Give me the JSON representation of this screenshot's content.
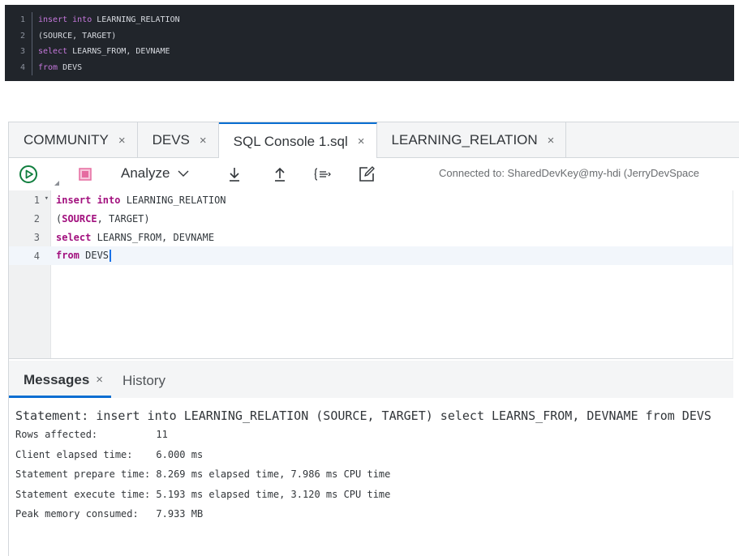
{
  "snippet": {
    "lines": [
      {
        "num": "1",
        "kw": "insert into",
        "rest": " LEARNING_RELATION"
      },
      {
        "num": "2",
        "kw": "",
        "rest": "(SOURCE, TARGET)"
      },
      {
        "num": "3",
        "kw": "select",
        "rest": " LEARNS_FROM, DEVNAME"
      },
      {
        "num": "4",
        "kw": "from",
        "rest": " DEVS"
      }
    ]
  },
  "tabs": [
    {
      "label": "COMMUNITY",
      "close": "×"
    },
    {
      "label": "DEVS",
      "close": "×"
    },
    {
      "label": "SQL Console 1.sql",
      "close": "×"
    },
    {
      "label": "LEARNING_RELATION",
      "close": "×"
    }
  ],
  "toolbar": {
    "analyze_label": "Analyze",
    "connection_text": "Connected to: SharedDevKey@my-hdi (JerryDevSpace"
  },
  "editor": {
    "lines": [
      {
        "num": "1",
        "fold": "▾",
        "kw": "insert into",
        "rest": " LEARNING_RELATION"
      },
      {
        "num": "2",
        "fold": "",
        "kw": "",
        "rest": "(SOURCE, TARGET)"
      },
      {
        "num": "3",
        "fold": "",
        "kw": "select",
        "rest": " LEARNS_FROM, DEVNAME"
      },
      {
        "num": "4",
        "fold": "",
        "kw": "from",
        "rest": " DEVS"
      }
    ],
    "line2_kw": "SOURCE"
  },
  "message_tabs": {
    "messages_label": "Messages",
    "messages_close": "×",
    "history_label": "History"
  },
  "messages": {
    "statement": "Statement: insert into LEARNING_RELATION (SOURCE, TARGET) select LEARNS_FROM, DEVNAME from DEVS",
    "stats": [
      "Rows affected:          11",
      "Client elapsed time:    6.000 ms",
      "Statement prepare time: 8.269 ms elapsed time, 7.986 ms CPU time",
      "Statement execute time: 5.193 ms elapsed time, 3.120 ms CPU time",
      "Peak memory consumed:   7.933 MB"
    ]
  },
  "colors": {
    "accent": "#0a6ed1",
    "run_green": "#107e3e",
    "stop_pink": "#e56ba0",
    "sql_keyword": "#a2107e",
    "snippet_keyword": "#c678dd"
  }
}
